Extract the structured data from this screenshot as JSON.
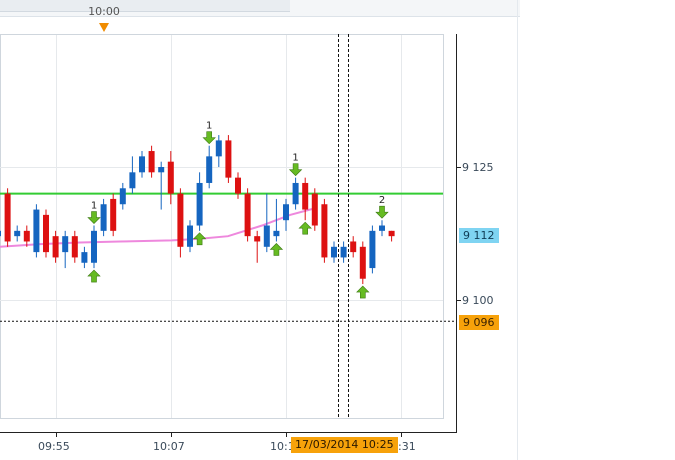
{
  "header": {
    "time_marker_label": "10:00",
    "time_marker_icon": "triangle-down-icon"
  },
  "price_axis": {
    "labels": [
      "9 125",
      "9 100"
    ],
    "current_price": "9 112",
    "crosshair_price": "9 096"
  },
  "time_axis": {
    "labels": [
      "09:55",
      "10:07",
      "10:1",
      ":31"
    ],
    "crosshair_time": "17/03/2014 10:25"
  },
  "colors": {
    "bull": "#1565c0",
    "bear": "#dd1111",
    "horizontal_line": "#33cc33",
    "moving_average": "#ee88dd",
    "arrow": "#66bb22",
    "current_badge": "#7fd4f2",
    "crosshair_badge": "#f7a20a"
  },
  "chart_data": {
    "type": "candlestick",
    "y_axis_ticks": [
      9125,
      9100
    ],
    "current_price": 9112,
    "crosshair_price": 9096,
    "horizontal_line_price": 9120,
    "candles": [
      {
        "dir": "up",
        "o": 9112,
        "c": 9113,
        "h": 9114,
        "l": 9111
      },
      {
        "dir": "down",
        "o": 9120,
        "c": 9111,
        "h": 9121,
        "l": 9110
      },
      {
        "dir": "up",
        "o": 9112,
        "c": 9113,
        "h": 9114,
        "l": 9111
      },
      {
        "dir": "down",
        "o": 9113,
        "c": 9111,
        "h": 9114,
        "l": 9110
      },
      {
        "dir": "up",
        "o": 9109,
        "c": 9117,
        "h": 9118,
        "l": 9108
      },
      {
        "dir": "down",
        "o": 9116,
        "c": 9109,
        "h": 9117,
        "l": 9108
      },
      {
        "dir": "down",
        "o": 9112,
        "c": 9108,
        "h": 9113,
        "l": 9107
      },
      {
        "dir": "up",
        "o": 9109,
        "c": 9112,
        "h": 9113,
        "l": 9106
      },
      {
        "dir": "down",
        "o": 9112,
        "c": 9108,
        "h": 9113,
        "l": 9107
      },
      {
        "dir": "up",
        "o": 9107,
        "c": 9109,
        "h": 9110,
        "l": 9106
      },
      {
        "dir": "up",
        "o": 9107,
        "c": 9113,
        "h": 9114,
        "l": 9106
      },
      {
        "dir": "up",
        "o": 9113,
        "c": 9118,
        "h": 9119,
        "l": 9112
      },
      {
        "dir": "down",
        "o": 9119,
        "c": 9113,
        "h": 9120,
        "l": 9112
      },
      {
        "dir": "up",
        "o": 9118,
        "c": 9121,
        "h": 9122,
        "l": 9117
      },
      {
        "dir": "up",
        "o": 9121,
        "c": 9124,
        "h": 9127,
        "l": 9120
      },
      {
        "dir": "up",
        "o": 9124,
        "c": 9127,
        "h": 9128,
        "l": 9123
      },
      {
        "dir": "down",
        "o": 9128,
        "c": 9124,
        "h": 9129,
        "l": 9123
      },
      {
        "dir": "up",
        "o": 9124,
        "c": 9125,
        "h": 9126,
        "l": 9117
      },
      {
        "dir": "down",
        "o": 9126,
        "c": 9120,
        "h": 9128,
        "l": 9118
      },
      {
        "dir": "down",
        "o": 9120,
        "c": 9110,
        "h": 9121,
        "l": 9108
      },
      {
        "dir": "up",
        "o": 9110,
        "c": 9114,
        "h": 9115,
        "l": 9109
      },
      {
        "dir": "up",
        "o": 9114,
        "c": 9122,
        "h": 9124,
        "l": 9113
      },
      {
        "dir": "up",
        "o": 9122,
        "c": 9127,
        "h": 9129,
        "l": 9121
      },
      {
        "dir": "up",
        "o": 9127,
        "c": 9130,
        "h": 9131,
        "l": 9125
      },
      {
        "dir": "down",
        "o": 9130,
        "c": 9123,
        "h": 9131,
        "l": 9122
      },
      {
        "dir": "down",
        "o": 9123,
        "c": 9120,
        "h": 9124,
        "l": 9119
      },
      {
        "dir": "down",
        "o": 9120,
        "c": 9112,
        "h": 9121,
        "l": 9111
      },
      {
        "dir": "down",
        "o": 9112,
        "c": 9111,
        "h": 9113,
        "l": 9107
      },
      {
        "dir": "up",
        "o": 9110,
        "c": 9114,
        "h": 9120,
        "l": 9109
      },
      {
        "dir": "up",
        "o": 9112,
        "c": 9113,
        "h": 9119,
        "l": 9111
      },
      {
        "dir": "up",
        "o": 9115,
        "c": 9118,
        "h": 9119,
        "l": 9113
      },
      {
        "dir": "up",
        "o": 9118,
        "c": 9122,
        "h": 9123,
        "l": 9117
      },
      {
        "dir": "down",
        "o": 9122,
        "c": 9117,
        "h": 9123,
        "l": 9115
      },
      {
        "dir": "down",
        "o": 9120,
        "c": 9114,
        "h": 9121,
        "l": 9113
      },
      {
        "dir": "down",
        "o": 9118,
        "c": 9108,
        "h": 9119,
        "l": 9107
      },
      {
        "dir": "up",
        "o": 9108,
        "c": 9110,
        "h": 9111,
        "l": 9107
      },
      {
        "dir": "up",
        "o": 9108,
        "c": 9110,
        "h": 9111,
        "l": 9107
      },
      {
        "dir": "down",
        "o": 9111,
        "c": 9109,
        "h": 9112,
        "l": 9108
      },
      {
        "dir": "down",
        "o": 9110,
        "c": 9104,
        "h": 9111,
        "l": 9103
      },
      {
        "dir": "up",
        "o": 9106,
        "c": 9113,
        "h": 9114,
        "l": 9105
      },
      {
        "dir": "up",
        "o": 9113,
        "c": 9114,
        "h": 9115,
        "l": 9112
      },
      {
        "dir": "down",
        "o": 9113,
        "c": 9112,
        "h": 9113,
        "l": 9111
      }
    ],
    "moving_average": [
      9110,
      9110.5,
      9110.8,
      9111,
      9111.2,
      9111.5,
      9112,
      9114,
      9116,
      9117.3
    ],
    "arrow_markers": [
      {
        "candle": 10,
        "dir": "down",
        "label": "1"
      },
      {
        "candle": 10,
        "dir": "up",
        "label": ""
      },
      {
        "candle": 21,
        "dir": "up",
        "label": ""
      },
      {
        "candle": 22,
        "dir": "down",
        "label": "1"
      },
      {
        "candle": 29,
        "dir": "up",
        "label": ""
      },
      {
        "candle": 31,
        "dir": "down",
        "label": "1"
      },
      {
        "candle": 32,
        "dir": "up",
        "label": ""
      },
      {
        "candle": 38,
        "dir": "up",
        "label": ""
      },
      {
        "candle": 40,
        "dir": "down",
        "label": "2"
      }
    ]
  }
}
